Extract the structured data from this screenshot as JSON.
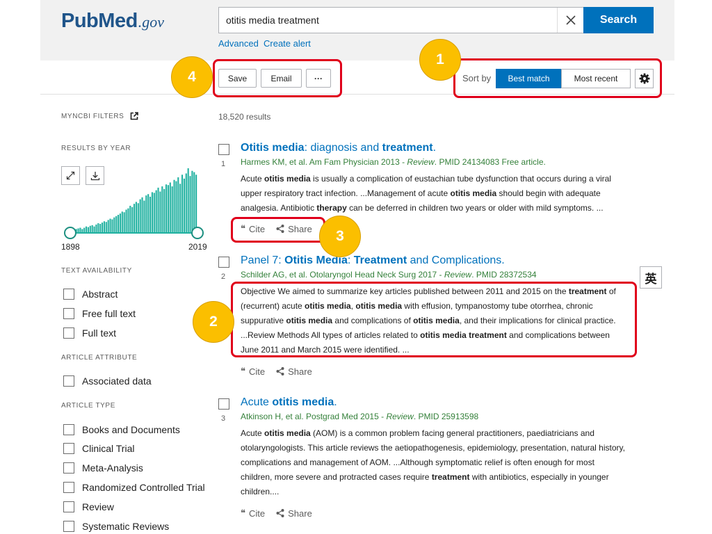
{
  "header": {
    "logo": {
      "word_a": "Pub",
      "word_b": "Med",
      "gov": ".gov"
    },
    "search_value": "otitis media treatment",
    "search_button": "Search",
    "links": [
      "Advanced",
      "Create alert"
    ]
  },
  "toolbar": {
    "save": "Save",
    "email": "Email",
    "more": "···",
    "sort_label": "Sort by",
    "sort_best": "Best match",
    "sort_recent": "Most recent"
  },
  "callouts": [
    "1",
    "2",
    "3",
    "4"
  ],
  "sidebar": {
    "myncbi": "MYNCBI FILTERS",
    "results_by_year": "RESULTS BY YEAR",
    "year_start": "1898",
    "year_end": "2019",
    "histogram_levels": [
      0.05,
      0.05,
      0.06,
      0.06,
      0.07,
      0.08,
      0.06,
      0.08,
      0.1,
      0.09,
      0.11,
      0.12,
      0.1,
      0.13,
      0.15,
      0.14,
      0.16,
      0.18,
      0.17,
      0.2,
      0.22,
      0.21,
      0.24,
      0.26,
      0.28,
      0.3,
      0.33,
      0.32,
      0.36,
      0.38,
      0.42,
      0.4,
      0.45,
      0.48,
      0.46,
      0.52,
      0.55,
      0.5,
      0.58,
      0.6,
      0.56,
      0.63,
      0.62,
      0.66,
      0.7,
      0.64,
      0.72,
      0.68,
      0.75,
      0.74,
      0.78,
      0.72,
      0.82,
      0.8,
      0.86,
      0.76,
      0.9,
      0.84,
      0.92,
      1.0,
      0.88,
      0.96,
      0.94,
      0.9
    ],
    "text_availability": "TEXT AVAILABILITY",
    "text_filters": [
      "Abstract",
      "Free full text",
      "Full text"
    ],
    "article_attribute": "ARTICLE ATTRIBUTE",
    "attribute_filters": [
      "Associated data"
    ],
    "article_type": "ARTICLE TYPE",
    "type_filters": [
      "Books and Documents",
      "Clinical Trial",
      "Meta-Analysis",
      "Randomized Controlled Trial",
      "Review",
      "Systematic Reviews"
    ]
  },
  "results_count": "18,520 results",
  "actions": {
    "cite": "Cite",
    "share": "Share"
  },
  "translate_glyph": "英",
  "results": [
    {
      "num": "1",
      "title": [
        [
          "Otitis media",
          true
        ],
        [
          ": diagnosis and ",
          false
        ],
        [
          "treatment",
          true
        ],
        [
          ".",
          false
        ]
      ],
      "citation": [
        [
          "Harmes KM, et al. Am Fam Physician 2013 - ",
          "n"
        ],
        [
          "Review",
          "i"
        ],
        [
          ". PMID 24134083 Free article.",
          "n"
        ]
      ],
      "snippet": [
        [
          [
            "Acute ",
            0
          ],
          [
            "otitis media",
            1
          ],
          [
            " is usually a complication of eustachian tube dysfunction that occurs during a viral",
            0
          ]
        ],
        [
          [
            "upper respiratory tract infection. ...Management of acute ",
            0
          ],
          [
            "otitis media",
            1
          ],
          [
            " should begin with adequate",
            0
          ]
        ],
        [
          [
            "analgesia. Antibiotic ",
            0
          ],
          [
            "therapy",
            1
          ],
          [
            " can be deferred in children two years or older with mild symptoms. ...",
            0
          ]
        ]
      ]
    },
    {
      "num": "2",
      "title": [
        [
          "Panel 7: ",
          false
        ],
        [
          "Otitis Media",
          true
        ],
        [
          ": ",
          false
        ],
        [
          "Treatment",
          true
        ],
        [
          " and Complications.",
          false
        ]
      ],
      "citation": [
        [
          "Schilder AG, et al. Otolaryngol Head Neck Surg 2017 - ",
          "n"
        ],
        [
          "Review",
          "i"
        ],
        [
          ". PMID 28372534",
          "n"
        ]
      ],
      "snippet": [
        [
          [
            "Objective We aimed to summarize key articles published between 2011 and 2015 on the ",
            0
          ],
          [
            "treatment",
            1
          ],
          [
            " of",
            0
          ]
        ],
        [
          [
            "(recurrent) acute ",
            0
          ],
          [
            "otitis media",
            1
          ],
          [
            ", ",
            0
          ],
          [
            "otitis media",
            1
          ],
          [
            " with effusion, tympanostomy tube otorrhea, chronic",
            0
          ]
        ],
        [
          [
            "suppurative ",
            0
          ],
          [
            "otitis media",
            1
          ],
          [
            " and complications of ",
            0
          ],
          [
            "otitis media",
            1
          ],
          [
            ", and their implications for clinical practice.",
            0
          ]
        ],
        [
          [
            "...Review Methods All types of articles related to ",
            0
          ],
          [
            "otitis media treatment",
            1
          ],
          [
            " and complications between",
            0
          ]
        ],
        [
          [
            "June 2011 and March 2015 were identified. ...",
            0
          ]
        ]
      ]
    },
    {
      "num": "3",
      "title": [
        [
          "Acute ",
          false
        ],
        [
          "otitis media",
          true
        ],
        [
          ".",
          false
        ]
      ],
      "citation": [
        [
          "Atkinson H, et al. Postgrad Med 2015 - ",
          "n"
        ],
        [
          "Review",
          "i"
        ],
        [
          ". PMID 25913598",
          "n"
        ]
      ],
      "snippet": [
        [
          [
            "Acute ",
            0
          ],
          [
            "otitis media",
            1
          ],
          [
            " (AOM) is a common problem facing general practitioners, paediatricians and",
            0
          ]
        ],
        [
          [
            "otolaryngologists. This article reviews the aetiopathogenesis, epidemiology, presentation, natural history,",
            0
          ]
        ],
        [
          [
            "complications and management of AOM. ...Although symptomatic relief is often enough for most",
            0
          ]
        ],
        [
          [
            "children, more severe and protracted cases require ",
            0
          ],
          [
            "treatment",
            1
          ],
          [
            " with antibiotics, especially in younger",
            0
          ]
        ],
        [
          [
            "children....",
            0
          ]
        ]
      ]
    }
  ],
  "colors": {
    "brand": "#20558a",
    "primary": "#0071bc",
    "citation_green": "#34803a",
    "histogram": "#20b1a0",
    "annotation_red": "#e0001b",
    "callout_yellow": "#fbbf00"
  }
}
